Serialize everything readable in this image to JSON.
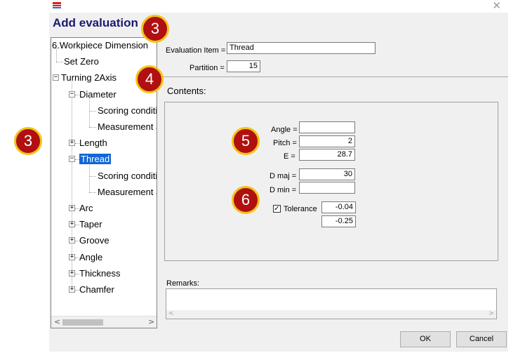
{
  "window": {
    "title": "Add evaluation",
    "close_glyph": "✕",
    "icon": "app-logo-icon"
  },
  "tree": {
    "items": [
      {
        "label": "6.Workpiece Dimension",
        "level": 0,
        "expander": "none"
      },
      {
        "label": "Set Zero",
        "level": 1,
        "expander": "none"
      },
      {
        "label": "Turning 2Axis",
        "level": 0,
        "expander": "−"
      },
      {
        "label": "Diameter",
        "level": 1,
        "expander": "−"
      },
      {
        "label": "Scoring conditio",
        "level": 2,
        "expander": "none"
      },
      {
        "label": "Measurement a",
        "level": 2,
        "expander": "none"
      },
      {
        "label": "Length",
        "level": 1,
        "expander": "+"
      },
      {
        "label": "Thread",
        "level": 1,
        "expander": "−",
        "selected": true
      },
      {
        "label": "Scoring conditio",
        "level": 2,
        "expander": "none"
      },
      {
        "label": "Measurement a",
        "level": 2,
        "expander": "none"
      },
      {
        "label": "Arc",
        "level": 1,
        "expander": "+"
      },
      {
        "label": "Taper",
        "level": 1,
        "expander": "+"
      },
      {
        "label": "Groove",
        "level": 1,
        "expander": "+"
      },
      {
        "label": "Angle",
        "level": 1,
        "expander": "+"
      },
      {
        "label": "Thickness",
        "level": 1,
        "expander": "+"
      },
      {
        "label": "Chamfer",
        "level": 1,
        "expander": "+"
      }
    ],
    "scroll_left": "<",
    "scroll_right": ">"
  },
  "form": {
    "evaluation_item_label": "Evaluation Item =",
    "evaluation_item_value": "Thread",
    "partition_label": "Partition =",
    "partition_value": "15",
    "contents_label": "Contents:",
    "angle_label": "Angle =",
    "angle_value": "",
    "pitch_label": "Pitch =",
    "pitch_value": "2",
    "e_label": "E =",
    "e_value": "28.7",
    "dmaj_label": "D maj =",
    "dmaj_value": "30",
    "dmin_label": "D min =",
    "dmin_value": "",
    "tolerance_label": "Tolerance",
    "tolerance_checked": "✓",
    "tolerance_upper": "-0.04",
    "tolerance_lower": "-0.25",
    "remarks_label": "Remarks:",
    "remarks_value": "",
    "remarks_scroll_left": "<",
    "remarks_scroll_right": ">"
  },
  "buttons": {
    "ok": "OK",
    "cancel": "Cancel"
  },
  "markers": {
    "m1": "3",
    "m2": "3",
    "m3": "4",
    "m4": "5",
    "m5": "6"
  },
  "colors": {
    "marker_fill": "#b01010",
    "marker_ring": "#f2c418",
    "selection": "#1166d6",
    "heading": "#1a1a70"
  }
}
